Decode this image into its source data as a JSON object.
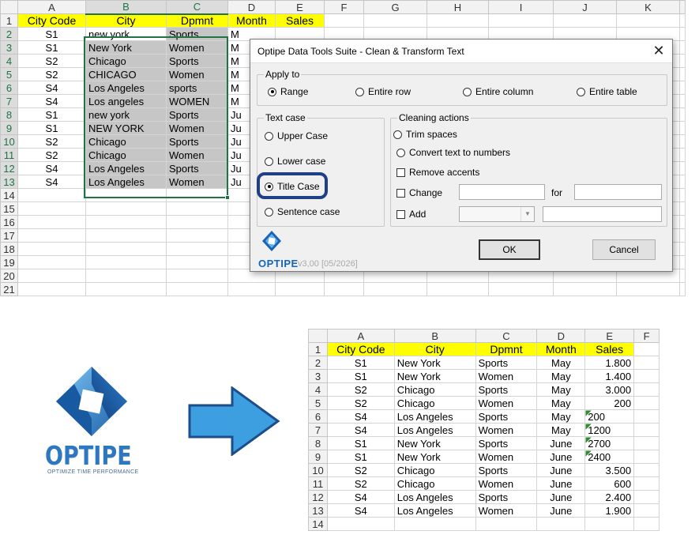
{
  "top_sheet": {
    "columns": [
      "A",
      "B",
      "C",
      "D",
      "E",
      "F",
      "G",
      "H",
      "I",
      "J",
      "K"
    ],
    "headers": [
      "City Code",
      "City",
      "Dpmnt",
      "Month",
      "Sales"
    ],
    "rows": [
      {
        "n": "2",
        "a": "S1",
        "b": "new york",
        "c": "Sports",
        "d": "M"
      },
      {
        "n": "3",
        "a": "S1",
        "b": "New York",
        "c": "Women",
        "d": "M"
      },
      {
        "n": "4",
        "a": "S2",
        "b": "Chicago",
        "c": "Sports",
        "d": "M"
      },
      {
        "n": "5",
        "a": "S2",
        "b": "CHICAGO",
        "c": "Women",
        "d": "M"
      },
      {
        "n": "6",
        "a": "S4",
        "b": "Los Angeles",
        "c": "sports",
        "d": "M"
      },
      {
        "n": "7",
        "a": "S4",
        "b": "Los angeles",
        "c": "WOMEN",
        "d": "M"
      },
      {
        "n": "8",
        "a": "S1",
        "b": "new york",
        "c": "Sports",
        "d": "Ju"
      },
      {
        "n": "9",
        "a": "S1",
        "b": "NEW YORK",
        "c": "Women",
        "d": "Ju"
      },
      {
        "n": "10",
        "a": "S2",
        "b": "Chicago",
        "c": "Sports",
        "d": "Ju"
      },
      {
        "n": "11",
        "a": "S2",
        "b": "Chicago",
        "c": "Women",
        "d": "Ju"
      },
      {
        "n": "12",
        "a": "S4",
        "b": "Los Angeles",
        "c": "Sports",
        "d": "Ju"
      },
      {
        "n": "13",
        "a": "S4",
        "b": "Los Angeles",
        "c": "Women",
        "d": "Ju"
      }
    ],
    "empty_rows": [
      "14",
      "15",
      "16",
      "17",
      "18",
      "19",
      "20",
      "21"
    ]
  },
  "dialog": {
    "title": "Optipe Data Tools Suite - Clean & Transform Text",
    "close_glyph": "✕",
    "apply_to": {
      "label": "Apply to",
      "options": [
        "Range",
        "Entire row",
        "Entire column",
        "Entire table"
      ],
      "selected": "Range"
    },
    "text_case": {
      "label": "Text case",
      "options": [
        "Upper Case",
        "Lower case",
        "Title Case",
        "Sentence case"
      ],
      "selected": "Title Case"
    },
    "cleaning": {
      "label": "Cleaning actions",
      "trim": "Trim spaces",
      "convert": "Convert text to numbers",
      "remove_accents": "Remove accents",
      "change": "Change",
      "for": "for",
      "add": "Add"
    },
    "ok_label": "OK",
    "cancel_label": "Cancel",
    "logo_word": "OPTIPE",
    "version": "v3,00 [05/2026]"
  },
  "big_logo": {
    "word": "OPTIPE",
    "tagline": "OPTIMIZE TIME PERFORMANCE",
    "arrow_color": "#3d9ee0"
  },
  "bottom_sheet": {
    "columns": [
      "A",
      "B",
      "C",
      "D",
      "E",
      "F"
    ],
    "headers": [
      "City Code",
      "City",
      "Dpmnt",
      "Month",
      "Sales"
    ],
    "rows": [
      {
        "n": "2",
        "a": "S1",
        "b": "New York",
        "c": "Sports",
        "d": "May",
        "e": "1.800",
        "txt": false
      },
      {
        "n": "3",
        "a": "S1",
        "b": "New York",
        "c": "Women",
        "d": "May",
        "e": "1.400",
        "txt": false
      },
      {
        "n": "4",
        "a": "S2",
        "b": "Chicago",
        "c": "Sports",
        "d": "May",
        "e": "3.000",
        "txt": false
      },
      {
        "n": "5",
        "a": "S2",
        "b": "Chicago",
        "c": "Women",
        "d": "May",
        "e": "200",
        "txt": false
      },
      {
        "n": "6",
        "a": "S4",
        "b": "Los Angeles",
        "c": "Sports",
        "d": "May",
        "e": "200",
        "txt": true
      },
      {
        "n": "7",
        "a": "S4",
        "b": "Los Angeles",
        "c": "Women",
        "d": "May",
        "e": "1200",
        "txt": true
      },
      {
        "n": "8",
        "a": "S1",
        "b": "New York",
        "c": "Sports",
        "d": "June",
        "e": "2700",
        "txt": true
      },
      {
        "n": "9",
        "a": "S1",
        "b": "New York",
        "c": "Women",
        "d": "June",
        "e": "2400",
        "txt": true
      },
      {
        "n": "10",
        "a": "S2",
        "b": "Chicago",
        "c": "Sports",
        "d": "June",
        "e": "3.500",
        "txt": false
      },
      {
        "n": "11",
        "a": "S2",
        "b": "Chicago",
        "c": "Women",
        "d": "June",
        "e": "600",
        "txt": false
      },
      {
        "n": "12",
        "a": "S4",
        "b": "Los Angeles",
        "c": "Sports",
        "d": "June",
        "e": "2.400",
        "txt": false
      },
      {
        "n": "13",
        "a": "S4",
        "b": "Los Angeles",
        "c": "Women",
        "d": "June",
        "e": "1.900",
        "txt": false
      }
    ],
    "empty_rows": [
      "14"
    ]
  }
}
